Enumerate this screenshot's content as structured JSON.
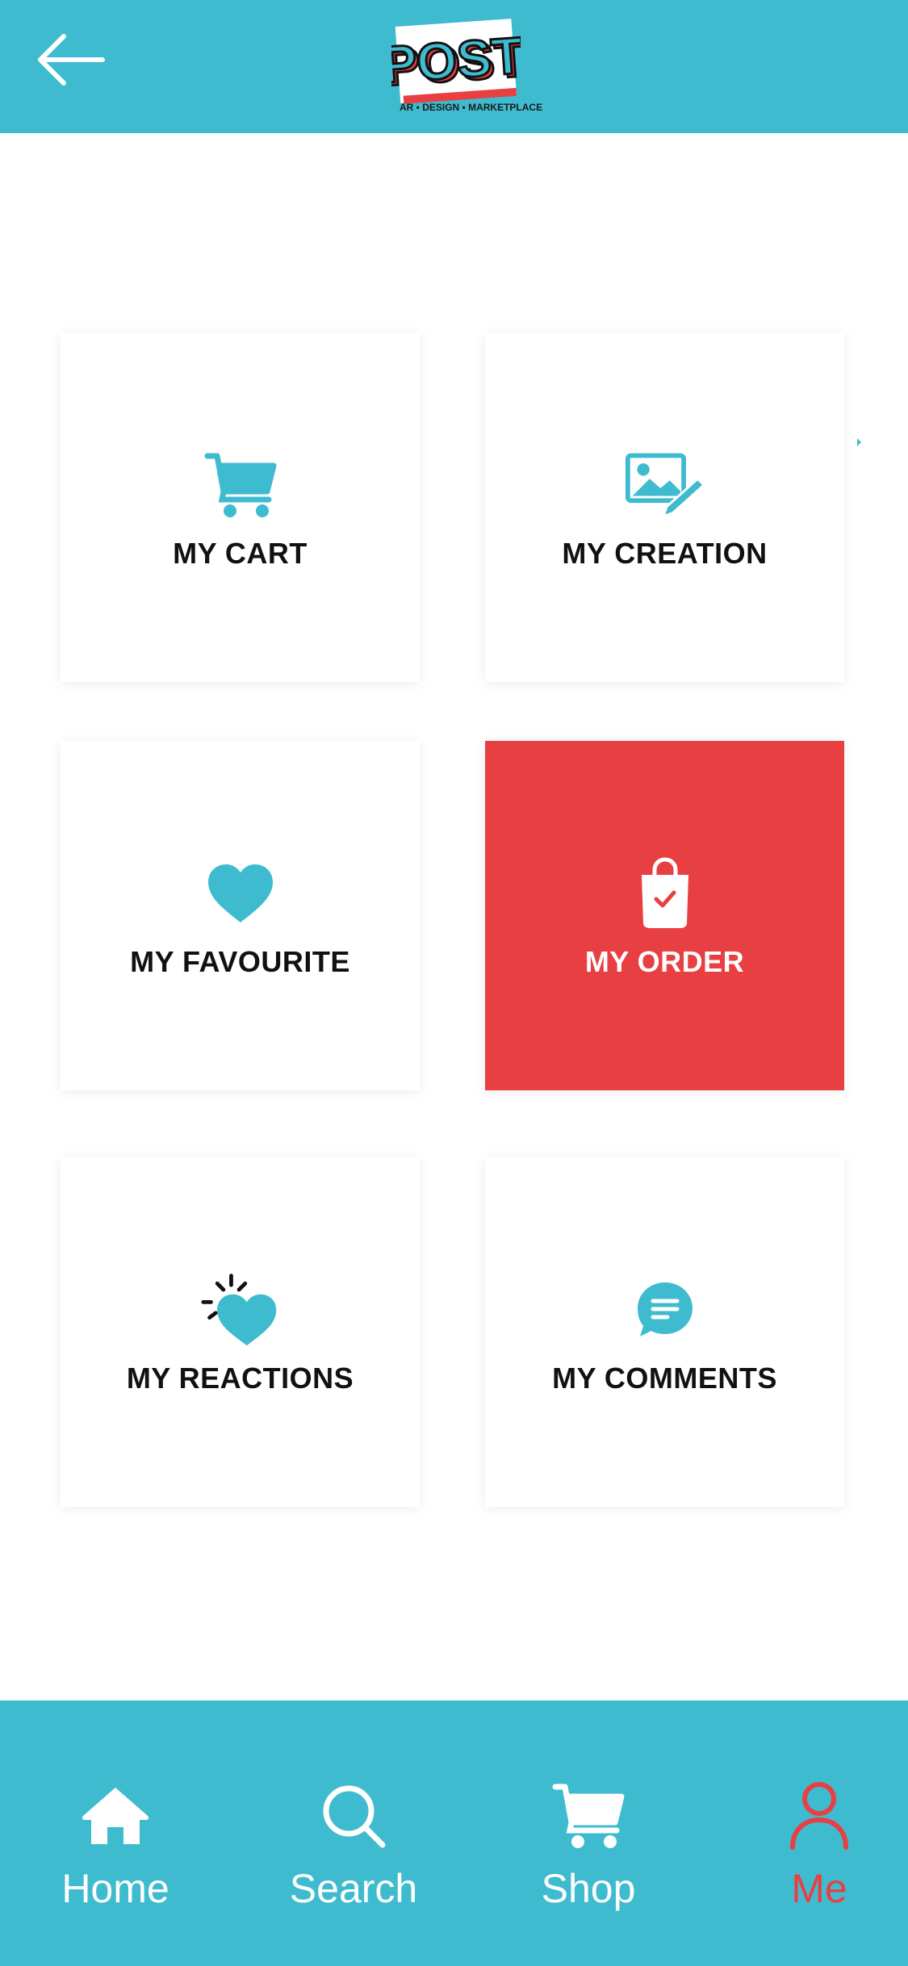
{
  "colors": {
    "primary": "#3fbbcf",
    "accent": "#e83f42",
    "text": "#111111",
    "white": "#ffffff"
  },
  "header": {
    "back_icon": "arrow-left-icon",
    "logo_text": "POST",
    "logo_tagline": "AR • DESIGN • MARKETPLACE"
  },
  "tiles": [
    {
      "label": "MY CART",
      "icon": "cart-icon",
      "active": false
    },
    {
      "label": "MY CREATION",
      "icon": "image-edit-icon",
      "active": false
    },
    {
      "label": "MY FAVOURITE",
      "icon": "heart-icon",
      "active": false
    },
    {
      "label": "MY ORDER",
      "icon": "shopping-bag-check-icon",
      "active": true
    },
    {
      "label": "MY REACTIONS",
      "icon": "heart-sparkle-icon",
      "active": false
    },
    {
      "label": "MY COMMENTS",
      "icon": "chat-bubble-icon",
      "active": false
    }
  ],
  "bottom_nav": [
    {
      "label": "Home",
      "icon": "home-icon",
      "active": false
    },
    {
      "label": "Search",
      "icon": "search-icon",
      "active": false
    },
    {
      "label": "Shop",
      "icon": "cart-icon",
      "active": false
    },
    {
      "label": "Me",
      "icon": "user-icon",
      "active": true
    }
  ]
}
